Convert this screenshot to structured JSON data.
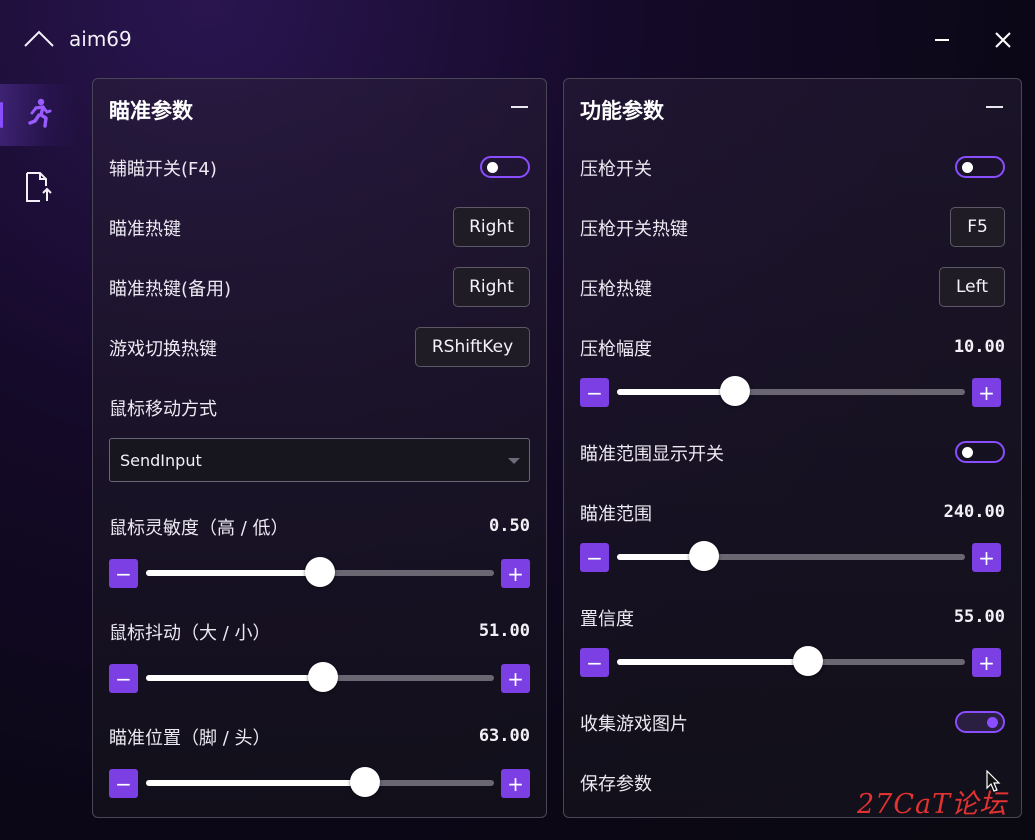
{
  "app": {
    "title": "aim69"
  },
  "sidebar": {
    "items": [
      {
        "icon": "running-person-icon",
        "active": true
      },
      {
        "icon": "file-export-icon",
        "active": false
      }
    ]
  },
  "left_panel": {
    "title": "瞄准参数",
    "aim_toggle": {
      "label": "辅瞄开关(F4)",
      "on": false
    },
    "aim_hotkey": {
      "label": "瞄准热键",
      "value": "Right"
    },
    "aim_hotkey_backup": {
      "label": "瞄准热键(备用)",
      "value": "Right"
    },
    "game_switch_hotkey": {
      "label": "游戏切换热键",
      "value": "RShiftKey"
    },
    "mouse_move_method": {
      "label": "鼠标移动方式",
      "value": "SendInput"
    },
    "sensitivity": {
      "label": "鼠标灵敏度（高 / 低）",
      "value": "0.50",
      "fraction": 0.5
    },
    "jitter": {
      "label": "鼠标抖动（大 / 小）",
      "value": "51.00",
      "fraction": 0.51
    },
    "aim_position": {
      "label": "瞄准位置（脚 / 头）",
      "value": "63.00",
      "fraction": 0.63
    }
  },
  "right_panel": {
    "title": "功能参数",
    "recoil_toggle": {
      "label": "压枪开关",
      "on": false
    },
    "recoil_toggle_hotkey": {
      "label": "压枪开关热键",
      "value": "F5"
    },
    "recoil_hotkey": {
      "label": "压枪热键",
      "value": "Left"
    },
    "recoil_strength": {
      "label": "压枪幅度",
      "value": "10.00",
      "fraction": 0.34
    },
    "aim_range_display": {
      "label": "瞄准范围显示开关",
      "on": false
    },
    "aim_range": {
      "label": "瞄准范围",
      "value": "240.00",
      "fraction": 0.25
    },
    "confidence": {
      "label": "置信度",
      "value": "55.00",
      "fraction": 0.55
    },
    "collect_images": {
      "label": "收集游戏图片",
      "on": true
    },
    "save_params": {
      "label": "保存参数"
    }
  },
  "watermark": "27CaT论坛",
  "colors": {
    "accent": "#7b3fe4",
    "toggle_border": "#8a4dff"
  }
}
